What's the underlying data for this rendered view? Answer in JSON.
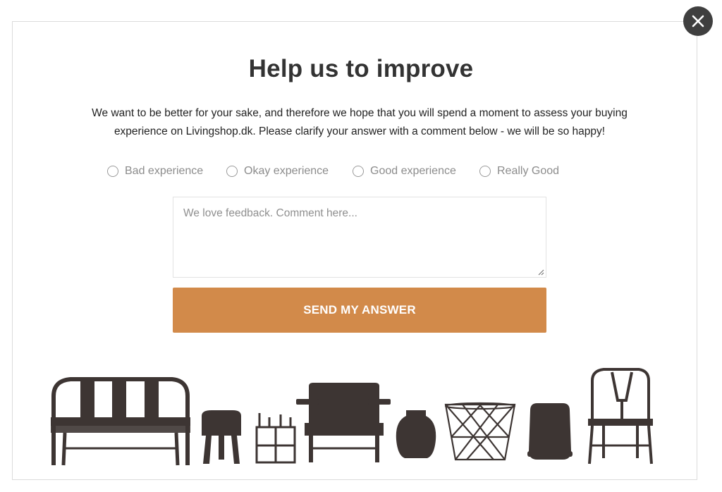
{
  "modal": {
    "title": "Help us to improve",
    "intro_line1": "We want to be better for your sake, and therefore we hope that you will spend a moment to assess your buying",
    "intro_line2": "experience on Livingshop.dk. Please clarify your answer with a comment below - we will be so happy!",
    "rating_options": [
      {
        "label": "Bad experience",
        "selected": false
      },
      {
        "label": "Okay experience",
        "selected": false
      },
      {
        "label": "Good experience",
        "selected": false
      },
      {
        "label": "Really Good",
        "selected": false
      }
    ],
    "comment": {
      "placeholder": "We love feedback. Comment here...",
      "value": ""
    },
    "submit_label": "SEND MY ANSWER"
  },
  "icons": {
    "close": "close-icon",
    "decoration": [
      "bench",
      "stool",
      "cube-shelf",
      "lounge-chair",
      "vase",
      "wire-basket",
      "bin",
      "wishbone-chair"
    ]
  },
  "colors": {
    "accent": "#d28a4a",
    "close_button": "#3f3f3f",
    "title": "#333333",
    "furniture": "#3d3533"
  }
}
